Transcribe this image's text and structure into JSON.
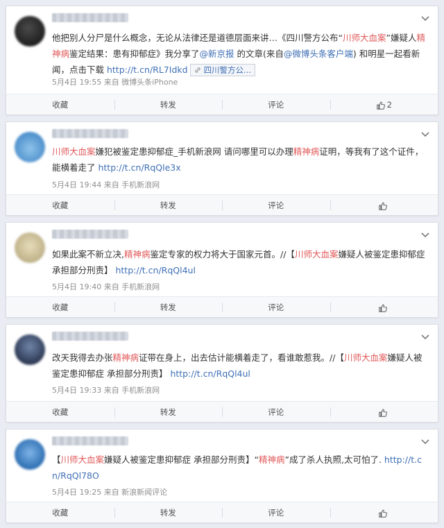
{
  "actions": {
    "collect": "收藏",
    "repost": "转发",
    "comment": "评论"
  },
  "posts": [
    {
      "user": "",
      "segments": [
        {
          "t": "他把别人分尸是什么概念，无论从法律还是道德层面来讲…《四川警方公布“",
          "c": ""
        },
        {
          "t": "川师大血案",
          "c": "red"
        },
        {
          "t": "”嫌疑人",
          "c": ""
        },
        {
          "t": "精神病",
          "c": "red"
        },
        {
          "t": "鉴定结果：患有抑郁症》我分享了",
          "c": ""
        },
        {
          "t": "@新京报",
          "c": "link"
        },
        {
          "t": " 的文章(来自",
          "c": ""
        },
        {
          "t": "@微博头条客户端",
          "c": "link"
        },
        {
          "t": ") 和明星一起看新闻，点击下载 ",
          "c": ""
        },
        {
          "t": "http://t.cn/RL7Idkd",
          "c": "link"
        }
      ],
      "tag": "四川警方公...",
      "meta": "5月4日 19:55 来自 微博头条iPhone",
      "likes": "2"
    },
    {
      "user": "",
      "segments": [
        {
          "t": "川师大血案",
          "c": "red"
        },
        {
          "t": "嫌犯被鉴定患抑郁症_手机新浪网 请问哪里可以办理",
          "c": ""
        },
        {
          "t": "精神病",
          "c": "red"
        },
        {
          "t": "证明，等我有了这个证件，能横着走了 ",
          "c": ""
        },
        {
          "t": "http://t.cn/RqQle3x",
          "c": "link"
        }
      ],
      "tag": "",
      "meta": "5月4日 19:44 来自 手机新浪网",
      "likes": ""
    },
    {
      "user": "",
      "segments": [
        {
          "t": "如果此案不新立决,",
          "c": ""
        },
        {
          "t": "精神病",
          "c": "red"
        },
        {
          "t": "鉴定专家的权力将大于国家元首。//【",
          "c": ""
        },
        {
          "t": "川师大血案",
          "c": "red"
        },
        {
          "t": "嫌疑人被鉴定患抑郁症承担部分刑责】 ",
          "c": ""
        },
        {
          "t": "http://t.cn/RqQl4ul",
          "c": "link"
        }
      ],
      "tag": "",
      "meta": "5月4日 19:40 来自 手机新浪网",
      "likes": ""
    },
    {
      "user": "",
      "segments": [
        {
          "t": "改天我得去办张",
          "c": ""
        },
        {
          "t": "精神病",
          "c": "red"
        },
        {
          "t": "证带在身上，出去估计能横着走了，看谁敢惹我。//【",
          "c": ""
        },
        {
          "t": "川师大血案",
          "c": "red"
        },
        {
          "t": "嫌疑人被鉴定患抑郁症 承担部分刑责】 ",
          "c": ""
        },
        {
          "t": "http://t.cn/RqQl4ul",
          "c": "link"
        }
      ],
      "tag": "",
      "meta": "5月4日 19:33 来自 手机新浪网",
      "likes": ""
    },
    {
      "user": "",
      "segments": [
        {
          "t": "【",
          "c": ""
        },
        {
          "t": "川师大血案",
          "c": "red"
        },
        {
          "t": "嫌疑人被鉴定患抑郁症 承担部分刑责】“",
          "c": ""
        },
        {
          "t": "精神病",
          "c": "red"
        },
        {
          "t": "”成了杀人执照,太可怕了. ",
          "c": ""
        },
        {
          "t": "http://t.cn/RqQl78O",
          "c": "link"
        }
      ],
      "tag": "",
      "meta": "5月4日 19:25 来自 新浪新闻评论",
      "likes": ""
    }
  ],
  "colors": {
    "highlight": "#e15a5a",
    "link": "#3f6fb5",
    "background": "#e9ecf2"
  },
  "icons": [
    "chevron-down-icon",
    "thumbs-up-icon",
    "link-icon"
  ]
}
